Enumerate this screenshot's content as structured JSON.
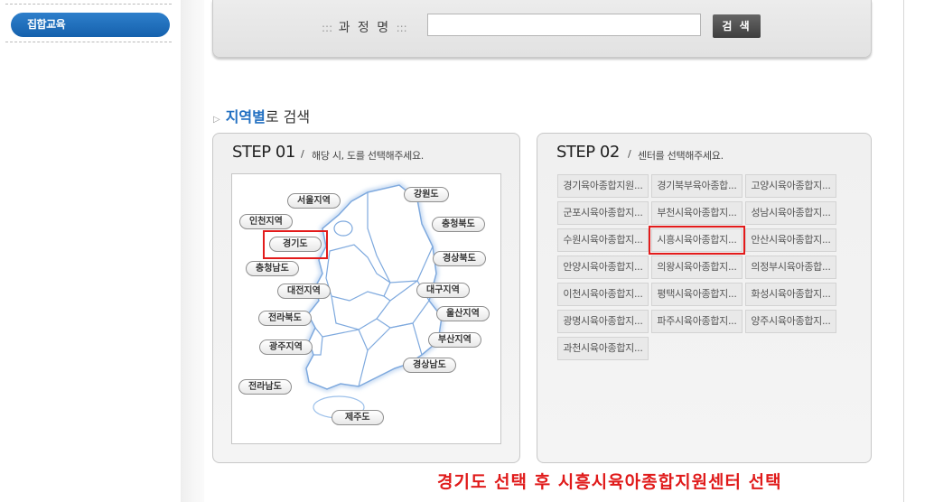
{
  "sidebar": {
    "active_item": "집합교육"
  },
  "search": {
    "label": "과 정 명",
    "label_deco": ":::",
    "input_value": "",
    "button": "검 색"
  },
  "section": {
    "title_highlight": "지역별",
    "title_rest": "로 검색"
  },
  "step1": {
    "title": "STEP 01",
    "sep": "/",
    "desc": "해당 시, 도를 선택해주세요.",
    "regions": [
      "서울지역",
      "강원도",
      "인천지역",
      "충청북도",
      "경기도",
      "경상북도",
      "충청남도",
      "대전지역",
      "대구지역",
      "울산지역",
      "전라북도",
      "부산지역",
      "광주지역",
      "경상남도",
      "전라남도",
      "제주도"
    ],
    "selected": "경기도"
  },
  "step2": {
    "title": "STEP 02",
    "sep": "/",
    "desc": "센터를 선택해주세요.",
    "centers": [
      "경기육아종합지원...",
      "경기북부육아종합...",
      "고양시육아종합지...",
      "군포시육아종합지...",
      "부천시육아종합지...",
      "성남시육아종합지...",
      "수원시육아종합지...",
      "시흥시육아종합지...",
      "안산시육아종합지...",
      "안양시육아종합지...",
      "의왕시육아종합지...",
      "의정부시육아종합...",
      "이천시육아종합지...",
      "평택시육아종합지...",
      "화성시육아종합지...",
      "광명시육아종합지...",
      "파주시육아종합지...",
      "양주시육아종합지...",
      "과천시육아종합지..."
    ],
    "selected": "시흥시육아종합지..."
  },
  "caption": "경기도 선택 후 시흥시육아종합지원센터 선택",
  "colors": {
    "accent_blue": "#2270c2",
    "highlight_red": "#e31b1b",
    "map_border": "#7ea9de"
  }
}
